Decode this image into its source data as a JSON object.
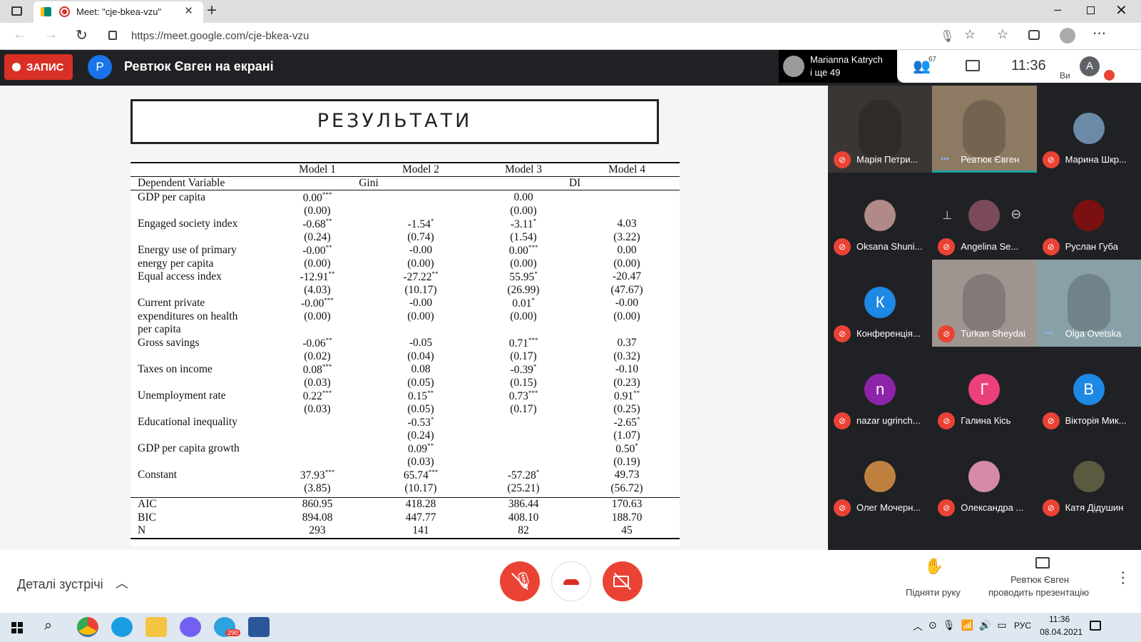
{
  "browser": {
    "tab_title": "Meet: \"cje-bkea-vzu\"",
    "url": "https://meet.google.com/cje-bkea-vzu"
  },
  "meet_bar": {
    "record_label": "ЗАПИС",
    "presenter_initial": "Р",
    "presenter_text": "Ревтюк Євген на екрані",
    "pinned_name": "Marianna Katrych",
    "pinned_sub": "і ще 49",
    "participants_count": "67",
    "time": "11:36",
    "self_label": "Ви",
    "self_initial": "A"
  },
  "slide": {
    "title": "РЕЗУЛЬТАТИ",
    "columns": [
      "Model 1",
      "Model 2",
      "Model 3",
      "Model 4"
    ],
    "dep_label": "Dependent Variable",
    "dep_gini": "Gini",
    "dep_di": "DI",
    "rows": [
      {
        "label": "GDP per capita",
        "coef": [
          "0.00***",
          "",
          "0.00",
          ""
        ],
        "se": [
          "(0.00)",
          "",
          "(0.00)",
          ""
        ]
      },
      {
        "label": "Engaged society index",
        "coef": [
          "-0.68**",
          "-1.54*",
          "-3.11*",
          "4.03"
        ],
        "se": [
          "(0.24)",
          "(0.74)",
          "(1.54)",
          "(3.22)"
        ]
      },
      {
        "label": "Energy use of primary",
        "label2": "energy per capita",
        "coef": [
          "-0.00**",
          "-0.00",
          "0.00***",
          "0.00"
        ],
        "se": [
          "(0.00)",
          "(0.00)",
          "(0.00)",
          "(0.00)"
        ]
      },
      {
        "label": "Equal access index",
        "coef": [
          "-12.91**",
          "-27.22**",
          "55.95*",
          "-20.47"
        ],
        "se": [
          "(4.03)",
          "(10.17)",
          "(26.99)",
          "(47.67)"
        ]
      },
      {
        "label": "Current private",
        "label2": "expenditures on health",
        "label3": "per capita",
        "coef": [
          "-0.00***",
          "-0.00",
          "0.01*",
          "-0.00"
        ],
        "se": [
          "(0.00)",
          "(0.00)",
          "(0.00)",
          "(0.00)"
        ]
      },
      {
        "label": "Gross savings",
        "coef": [
          "-0.06**",
          "-0.05",
          "0.71***",
          "0.37"
        ],
        "se": [
          "(0.02)",
          "(0.04)",
          "(0.17)",
          "(0.32)"
        ]
      },
      {
        "label": "Taxes on income",
        "coef": [
          "0.08***",
          "0.08",
          "-0.39*",
          "-0.10"
        ],
        "se": [
          "(0.03)",
          "(0.05)",
          "(0.15)",
          "(0.23)"
        ]
      },
      {
        "label": "Unemployment rate",
        "coef": [
          "0.22***",
          "0.15**",
          "0.73***",
          "0.91**"
        ],
        "se": [
          "(0.03)",
          "(0.05)",
          "(0.17)",
          "(0.25)"
        ]
      },
      {
        "label": "Educational inequality",
        "coef": [
          "",
          "-0.53*",
          "",
          "-2.65*"
        ],
        "se": [
          "",
          "(0.24)",
          "",
          "(1.07)"
        ]
      },
      {
        "label": "GDP per capita growth",
        "coef": [
          "",
          "0.09**",
          "",
          "0.50*"
        ],
        "se": [
          "",
          "(0.03)",
          "",
          "(0.19)"
        ]
      },
      {
        "label": "Constant",
        "coef": [
          "37.93***",
          "65.74***",
          "-57.28*",
          "49.73"
        ],
        "se": [
          "(3.85)",
          "(10.17)",
          "(25.21)",
          "(56.72)"
        ]
      }
    ],
    "stats": [
      {
        "label": "AIC",
        "values": [
          "860.95",
          "418.28",
          "386.44",
          "170.63"
        ]
      },
      {
        "label": "BIC",
        "values": [
          "894.08",
          "447.77",
          "408.10",
          "188.70"
        ]
      },
      {
        "label": "N",
        "values": [
          "293",
          "141",
          "82",
          "45"
        ]
      }
    ]
  },
  "participants": [
    {
      "name": "Марія Петри...",
      "kind": "video",
      "color": "#3a3634"
    },
    {
      "name": "Ревтюк Євген",
      "kind": "video",
      "color": "#8c7a62",
      "speaking": true
    },
    {
      "name": "Марина Шкр...",
      "kind": "photo",
      "color": "#6b8aa8"
    },
    {
      "name": "Oksana Shuni...",
      "kind": "photo",
      "color": "#b08a86"
    },
    {
      "name": "Angelina Se...",
      "kind": "photo",
      "color": "#7a4a5a",
      "hover": true
    },
    {
      "name": "Руслан Губа",
      "kind": "photo",
      "color": "#7a1010"
    },
    {
      "name": "Конференція...",
      "kind": "initial",
      "initial": "К",
      "color": "#1e88e5"
    },
    {
      "name": "Turkan Sheydai",
      "kind": "video",
      "color": "#9e9590"
    },
    {
      "name": "Olga Ovetska",
      "kind": "video",
      "color": "#8aa0a8",
      "speaking": true
    },
    {
      "name": "nazar ugrinch...",
      "kind": "initial",
      "initial": "n",
      "color": "#8e24aa"
    },
    {
      "name": "Галина Кісь",
      "kind": "initial",
      "initial": "Г",
      "color": "#ec407a"
    },
    {
      "name": "Вікторія Мик...",
      "kind": "initial",
      "initial": "В",
      "color": "#1e88e5"
    },
    {
      "name": "Олег Мочерн...",
      "kind": "photo",
      "color": "#c08040"
    },
    {
      "name": "Олександра ...",
      "kind": "photo",
      "color": "#d48aa8"
    },
    {
      "name": "Катя Дідушин",
      "kind": "photo",
      "color": "#5a5a40"
    }
  ],
  "bottom": {
    "details": "Деталі зустрічі",
    "raise_hand": "Підняти руку",
    "presenting_line1": "Ревтюк Євген",
    "presenting_line2": "проводить презентацію"
  },
  "taskbar": {
    "lang": "РУС",
    "time": "11:36",
    "date": "08.04.2021",
    "telegram_badge": "290"
  }
}
